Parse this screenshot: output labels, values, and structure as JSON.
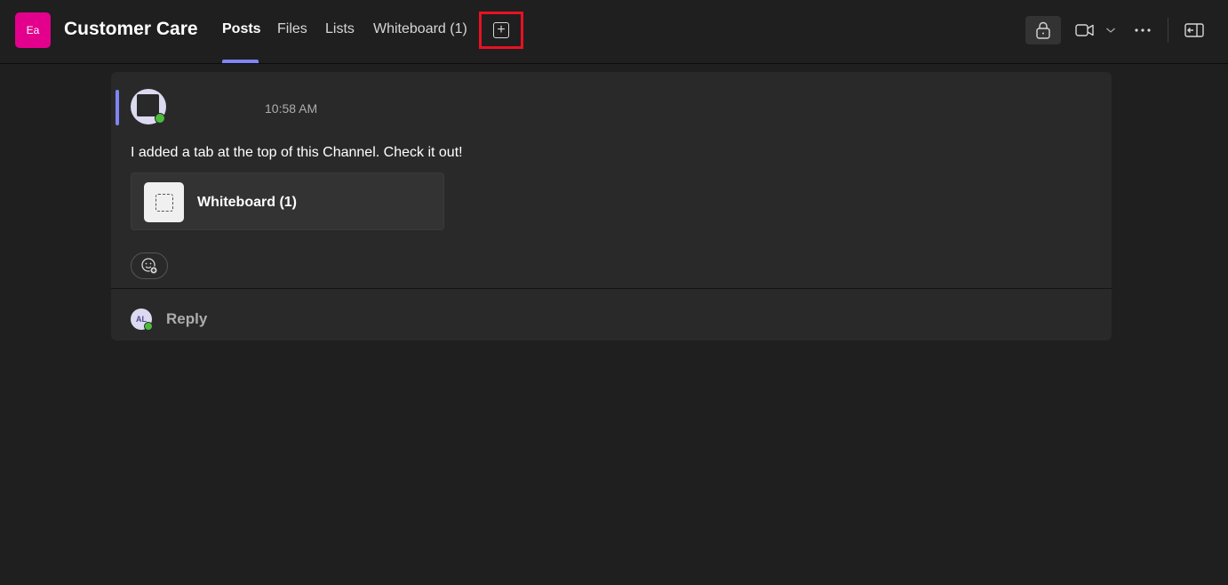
{
  "header": {
    "team_avatar_initials": "Ea",
    "team_avatar_color": "#e3008c",
    "channel_name": "Customer Care",
    "tabs": [
      {
        "label": "Posts",
        "active": true
      },
      {
        "label": "Files",
        "active": false
      },
      {
        "label": "Lists",
        "active": false
      },
      {
        "label": "Whiteboard (1)",
        "active": false
      }
    ],
    "add_tab_icon": "add-square-icon",
    "accent_color": "#7f85f5",
    "highlight_color": "#e81123",
    "tools": {
      "lock_icon": "lock-icon",
      "video_icon": "video-camera-icon",
      "dropdown_icon": "chevron-down-icon",
      "more_icon": "more-horizontal-icon",
      "panel_icon": "open-panel-icon"
    }
  },
  "post": {
    "timestamp": "10:58 AM",
    "message": "I added a tab at the top of this Channel. Check it out!",
    "attachment": {
      "name": "Whiteboard (1)",
      "icon": "whiteboard-icon"
    },
    "reaction_icon": "add-reaction-icon",
    "presence_color": "#4cbb3c",
    "reply": {
      "avatar_initials": "AL",
      "label": "Reply"
    }
  }
}
